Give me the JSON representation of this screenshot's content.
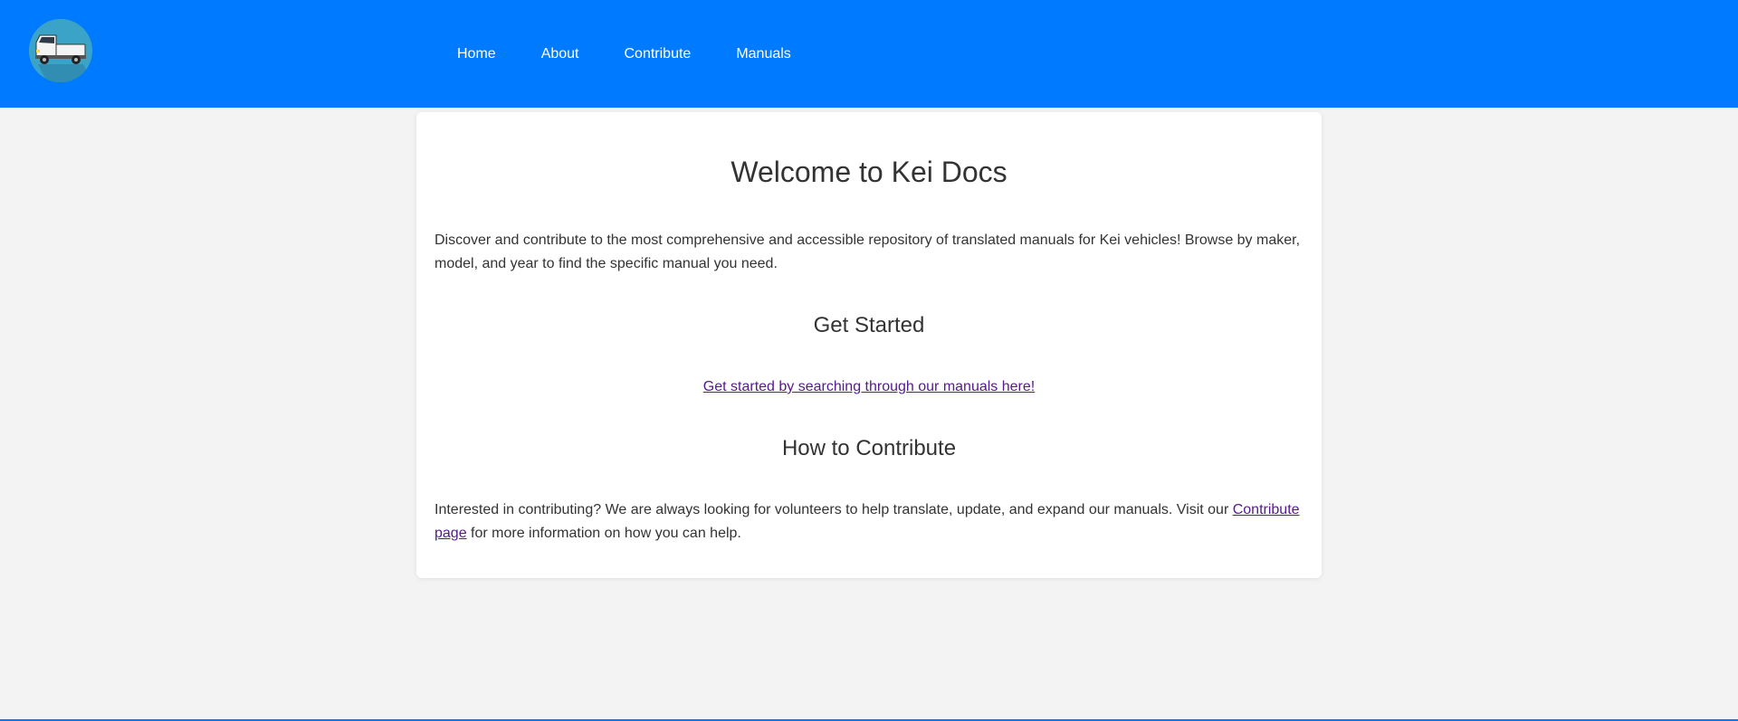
{
  "header": {
    "logo_icon": "kei-truck-logo-icon",
    "nav": [
      {
        "label": "Home"
      },
      {
        "label": "About"
      },
      {
        "label": "Contribute"
      },
      {
        "label": "Manuals"
      }
    ],
    "bg_color": "#007bff"
  },
  "main": {
    "title": "Welcome to Kei Docs",
    "intro": "Discover and contribute to the most comprehensive and accessible repository of translated manuals for Kei vehicles! Browse by maker, model, and year to find the specific manual you need.",
    "get_started": {
      "heading": "Get Started",
      "link_text": "Get started by searching through our manuals here!"
    },
    "contribute": {
      "heading": "How to Contribute",
      "text_before": "Interested in contributing? We are always looking for volunteers to help translate, update, and expand our manuals. Visit our ",
      "link_text": "Contribute page",
      "text_after": " for more information on how you can help."
    }
  },
  "colors": {
    "accent": "#007bff",
    "link_visited": "#551a8b",
    "page_bg": "#f3f3f3",
    "text": "#333333"
  }
}
